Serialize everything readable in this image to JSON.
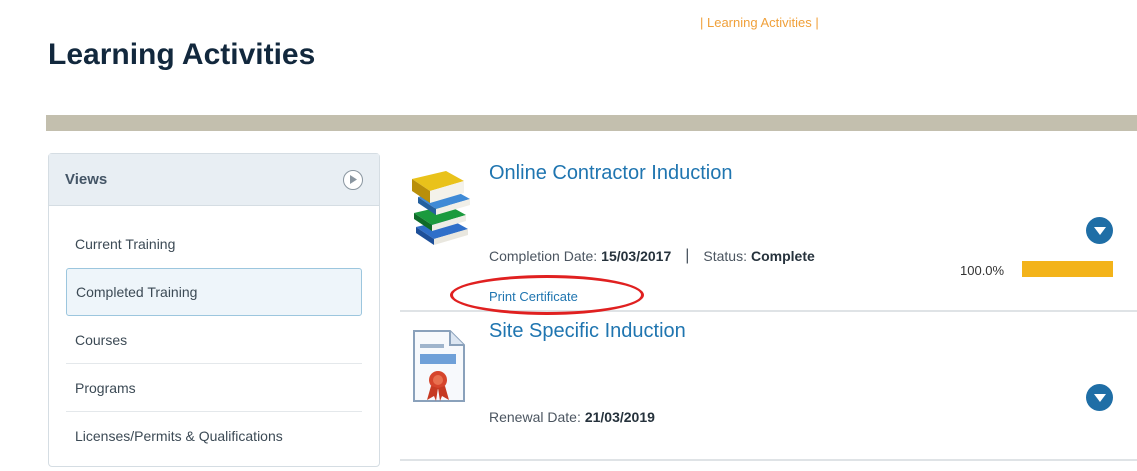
{
  "header": {
    "crumb": "| Learning Activities |",
    "title": "Learning Activities"
  },
  "sidebar": {
    "title": "Views",
    "items": [
      {
        "label": "Current Training",
        "active": false
      },
      {
        "label": "Completed Training",
        "active": true
      },
      {
        "label": "Courses",
        "active": false
      },
      {
        "label": "Programs",
        "active": false
      },
      {
        "label": "Licenses/Permits & Qualifications",
        "active": false
      }
    ]
  },
  "courses": [
    {
      "title": "Online Contractor Induction",
      "icon": "books-icon",
      "date_label": "Completion Date:",
      "date_value": "15/03/2017",
      "separator": "|",
      "status_label": "Status:",
      "status_value": "Complete",
      "action_label": "Print Certificate",
      "progress_text": "100.0%",
      "progress": 1.0
    },
    {
      "title": "Site Specific Induction",
      "icon": "certificate-icon",
      "date_label": "Renewal Date:",
      "date_value": "21/03/2019"
    }
  ],
  "colors": {
    "accent": "#1f75b0",
    "progress": "#f3b31a",
    "highlight": "#e02020"
  }
}
